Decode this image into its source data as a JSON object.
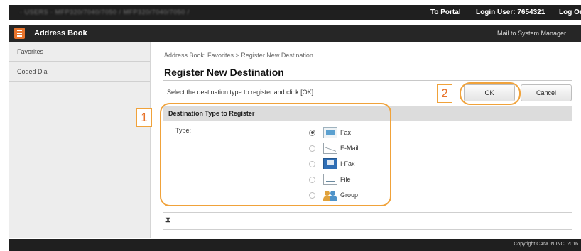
{
  "topbar": {
    "blurred_text": "· USERS ·    MFP320/7040/7050 / MFP320/7040/7050 /",
    "to_portal": "To Portal",
    "login_user": "Login User:  7654321",
    "logout": "Log Out"
  },
  "header": {
    "app_title": "Address Book",
    "mail_link": "Mail to System Manager"
  },
  "sidebar": {
    "items": [
      {
        "label": "Favorites"
      },
      {
        "label": "Coded Dial"
      }
    ]
  },
  "main": {
    "breadcrumb": "Address Book: Favorites > Register New Destination",
    "title": "Register New Destination",
    "instruction": "Select the destination type to register and click [OK].",
    "ok_label": "OK",
    "cancel_label": "Cancel",
    "callout_1": "1",
    "callout_2": "2",
    "section_title": "Destination Type to Register",
    "type_label": "Type:",
    "options": [
      {
        "label": "Fax",
        "icon": "fax-icon",
        "checked": true
      },
      {
        "label": "E-Mail",
        "icon": "email-icon",
        "checked": false
      },
      {
        "label": "I-Fax",
        "icon": "ifax-icon",
        "checked": false
      },
      {
        "label": "File",
        "icon": "file-icon",
        "checked": false
      },
      {
        "label": "Group",
        "icon": "group-icon",
        "checked": false
      }
    ],
    "collapse_glyph": "⧗"
  },
  "footer": {
    "copyright": "Copyright CANON INC. 2016"
  },
  "colors": {
    "highlight": "#f0a23a",
    "callout_text": "#e8742c",
    "topbar_bg": "#1f1f1f",
    "sidebar_bg": "#ededed",
    "section_head_bg": "#dcdcdc"
  }
}
